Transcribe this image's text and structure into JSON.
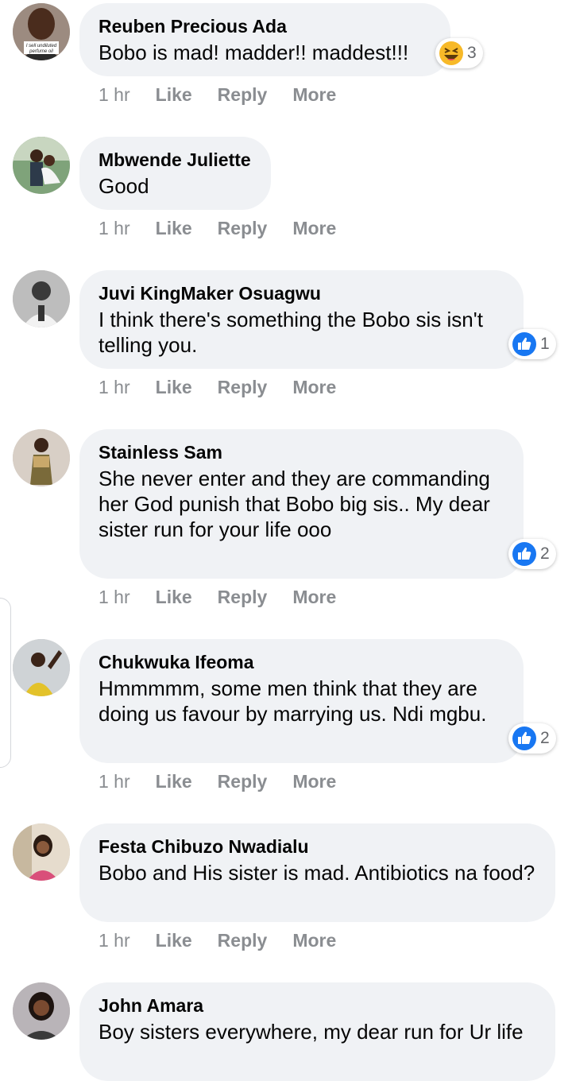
{
  "labels": {
    "like": "Like",
    "reply": "Reply",
    "more": "More"
  },
  "comments": [
    {
      "author": "Reuben Precious Ada",
      "text": "Bobo is mad! madder!! maddest!!!",
      "time": "1 hr",
      "reaction": "laugh",
      "reaction_count": "3",
      "avatar_text": "I sell undiluted perfume oil materials"
    },
    {
      "author": "Mbwende Juliette",
      "text": "Good",
      "time": "1 hr"
    },
    {
      "author": "Juvi KingMaker Osuagwu",
      "text": "I think there's something the Bobo sis isn't telling you.",
      "time": "1 hr",
      "reaction": "like",
      "reaction_count": "1"
    },
    {
      "author": "Stainless Sam",
      "text": "She never enter and they are commanding her God punish that Bobo big sis.. My dear sister run for your life ooo",
      "time": "1 hr",
      "reaction": "like",
      "reaction_count": "2"
    },
    {
      "author": "Chukwuka Ifeoma",
      "text": "Hmmmmm, some men think that they are doing us favour by marrying us. Ndi mgbu.",
      "time": "1 hr",
      "reaction": "like",
      "reaction_count": "2"
    },
    {
      "author": "Festa Chibuzo Nwadialu",
      "text": "Bobo and His sister is mad. Antibiotics na food?",
      "time": "1 hr"
    },
    {
      "author": "John Amara",
      "text": "Boy sisters everywhere, my dear run for Ur life"
    }
  ],
  "colors": {
    "bubble": "#f0f2f5",
    "meta": "#8a8d91",
    "like_blue": "#1877f2",
    "laugh_yellow": "#f7b928"
  }
}
